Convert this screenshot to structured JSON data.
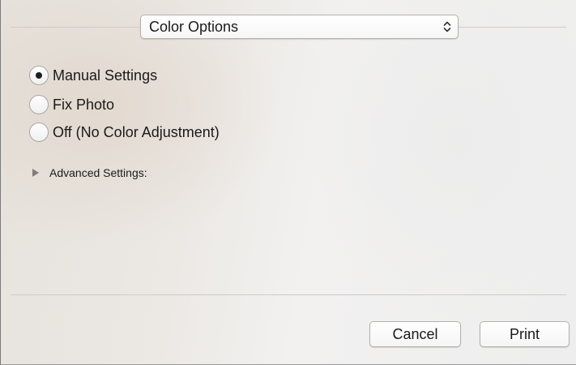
{
  "popup": {
    "selected": "Color Options",
    "icon": "chevron-updown-icon"
  },
  "options": [
    {
      "label": "Manual Settings",
      "checked": true
    },
    {
      "label": "Fix Photo",
      "checked": false
    },
    {
      "label": "Off (No Color Adjustment)",
      "checked": false
    }
  ],
  "advanced": {
    "label": "Advanced Settings:",
    "icon": "disclosure-triangle-icon",
    "expanded": false
  },
  "buttons": {
    "cancel": "Cancel",
    "print": "Print"
  }
}
